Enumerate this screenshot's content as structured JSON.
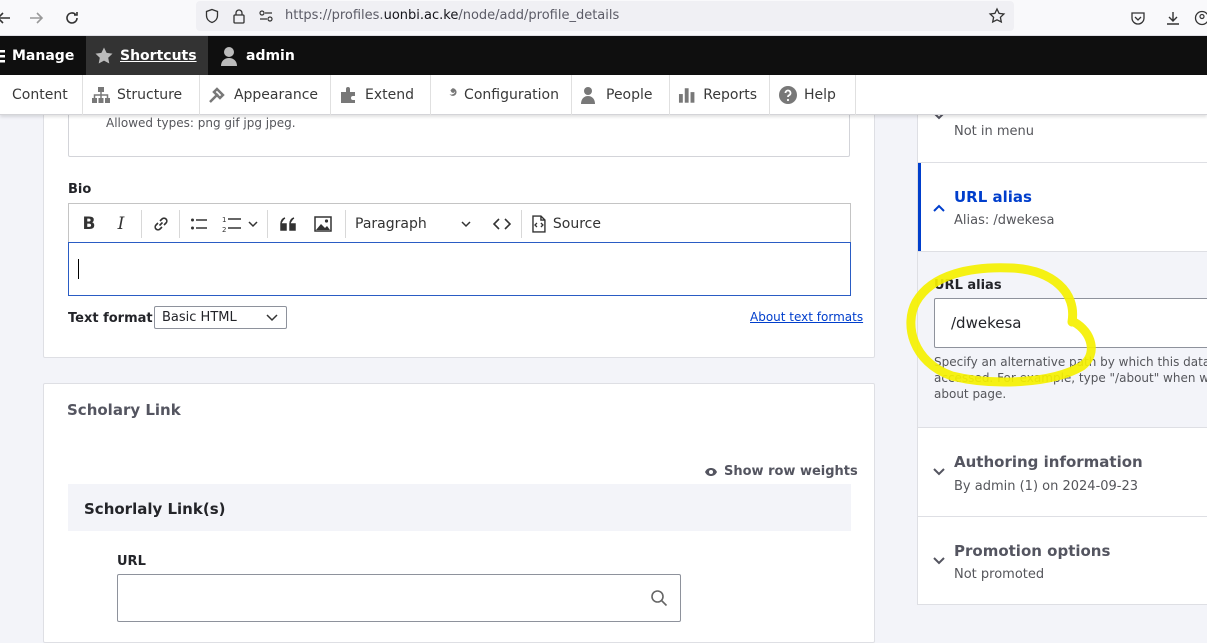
{
  "browser": {
    "url_prefix": "https://profiles.",
    "url_domain": "uonbi.ac.ke",
    "url_path": "/node/add/profile_details"
  },
  "toolbar": {
    "manage": "Manage",
    "shortcuts": "Shortcuts",
    "user": "admin"
  },
  "tray": {
    "items": [
      {
        "label": "Content",
        "icon": "content-icon"
      },
      {
        "label": "Structure",
        "icon": "structure-icon"
      },
      {
        "label": "Appearance",
        "icon": "appearance-icon"
      },
      {
        "label": "Extend",
        "icon": "extend-icon"
      },
      {
        "label": "Configuration",
        "icon": "wrench-icon"
      },
      {
        "label": "People",
        "icon": "people-icon"
      },
      {
        "label": "Reports",
        "icon": "reports-icon"
      },
      {
        "label": "Help",
        "icon": "help-icon"
      }
    ]
  },
  "image_field": {
    "allowed_types": "Allowed types: png gif jpg jpeg."
  },
  "bio": {
    "label": "Bio",
    "paragraph_label": "Paragraph",
    "source_label": "Source",
    "text_format_label": "Text format",
    "text_format_value": "Basic HTML",
    "about_link": "About text formats"
  },
  "scholary": {
    "title": "Scholary Link",
    "show_weights": "Show row weights",
    "table_header": "Schorlaly Link(s)",
    "url_label": "URL",
    "url_value": ""
  },
  "sidebar": {
    "menu_sub": "Not in menu",
    "url_alias_title": "URL alias",
    "url_alias_sub": "Alias: /dwekesa",
    "alias_label": "URL alias",
    "alias_value": "/dwekesa",
    "alias_desc_1": "Specify an alternative path by which this data ca",
    "alias_desc_2": "accessed. For example, type \"/about\" when wri",
    "alias_desc_3": "about page.",
    "authoring_title": "Authoring information",
    "authoring_sub": "By admin (1) on 2024-09-23",
    "promotion_title": "Promotion options",
    "promotion_sub": "Not promoted"
  },
  "colors": {
    "accent": "#003ecc",
    "highlight": "#f5f000"
  }
}
